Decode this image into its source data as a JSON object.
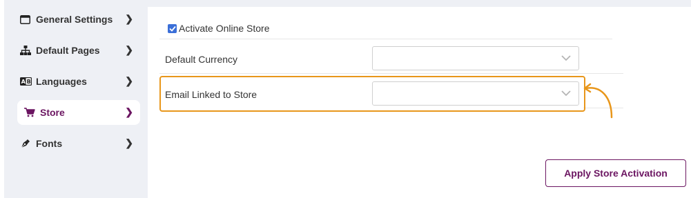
{
  "sidebar": {
    "items": [
      {
        "label": "General Settings",
        "icon": "window-icon"
      },
      {
        "label": "Default Pages",
        "icon": "sitemap-icon"
      },
      {
        "label": "Languages",
        "icon": "language-icon"
      },
      {
        "label": "Store",
        "icon": "cart-icon",
        "active": true
      },
      {
        "label": "Fonts",
        "icon": "pen-nib-icon"
      }
    ]
  },
  "store_settings": {
    "activate_label": "Activate Online Store",
    "activate_checked": true,
    "currency_label": "Default Currency",
    "currency_value": "",
    "email_label": "Email Linked to Store",
    "email_value": ""
  },
  "actions": {
    "apply_label": "Apply Store Activation"
  },
  "colors": {
    "accent": "#6b1561",
    "highlight": "#e8961a",
    "checkbox": "#3b6fd8",
    "sidebar_bg": "#eef0f5"
  }
}
